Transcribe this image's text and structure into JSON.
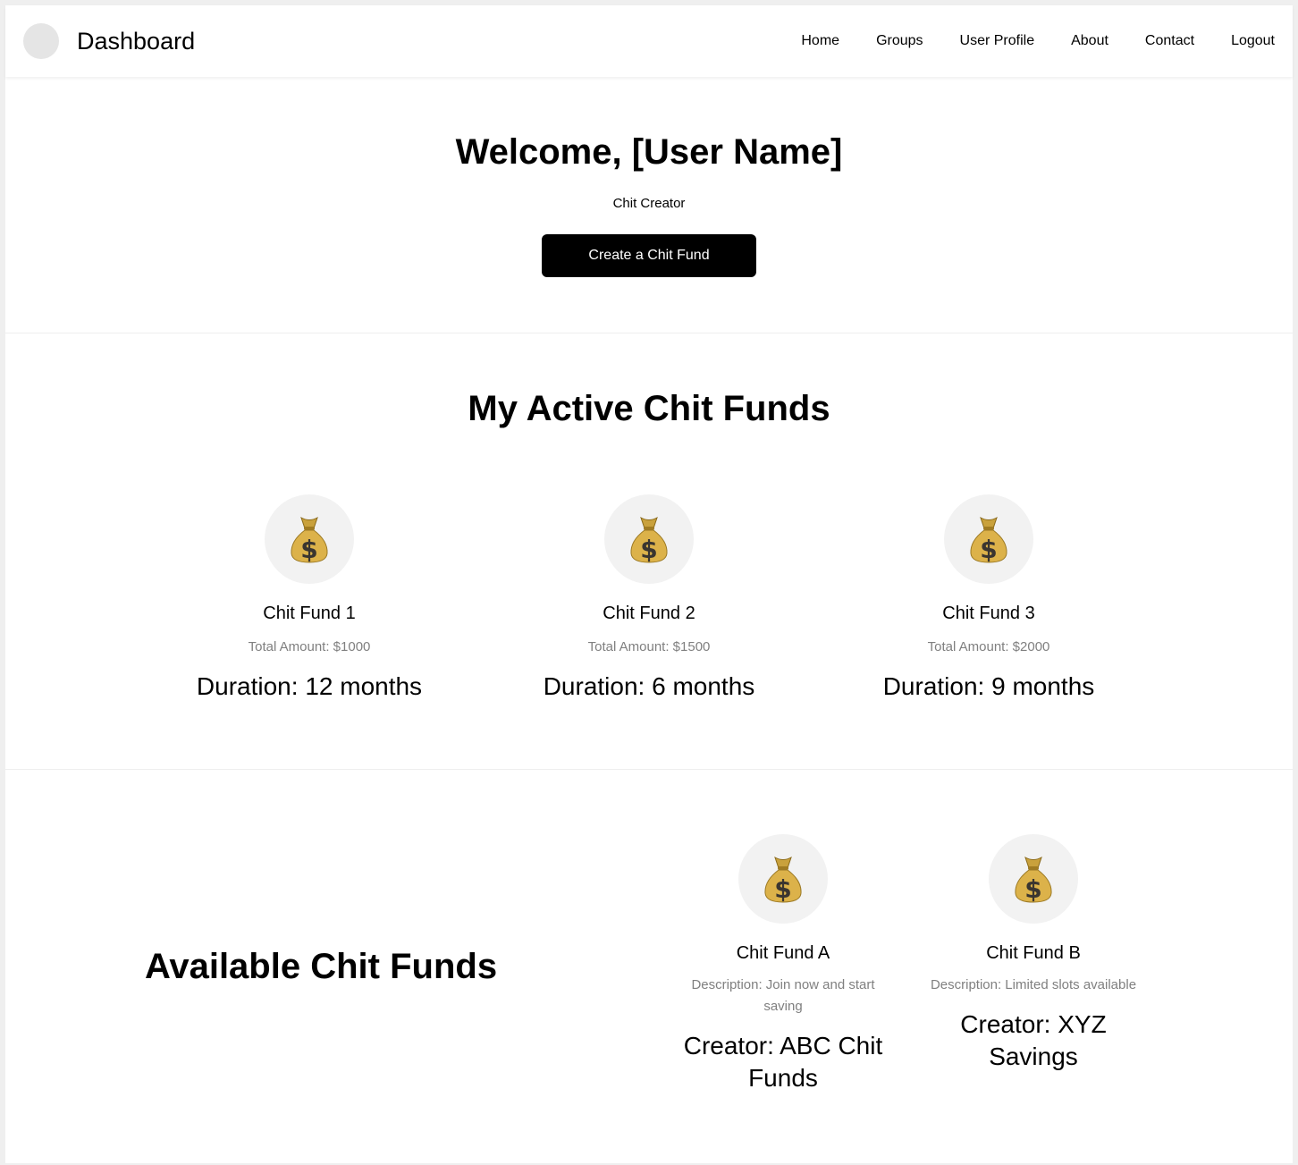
{
  "header": {
    "title": "Dashboard",
    "nav": [
      "Home",
      "Groups",
      "User Profile",
      "About",
      "Contact",
      "Logout"
    ]
  },
  "welcome": {
    "title": "Welcome, [User Name]",
    "role": "Chit Creator",
    "button": "Create a Chit Fund"
  },
  "active": {
    "title": "My Active Chit Funds",
    "cards": [
      {
        "icon": "money-bag-icon",
        "name": "Chit Fund 1",
        "amount": "Total Amount: $1000",
        "duration": "Duration: 12 months"
      },
      {
        "icon": "money-bag-icon",
        "name": "Chit Fund 2",
        "amount": "Total Amount: $1500",
        "duration": "Duration: 6 months"
      },
      {
        "icon": "money-bag-icon",
        "name": "Chit Fund 3",
        "amount": "Total Amount: $2000",
        "duration": "Duration: 9 months"
      }
    ]
  },
  "available": {
    "title": "Available Chit Funds",
    "cards": [
      {
        "icon": "money-bag-icon",
        "name": "Chit Fund A",
        "description": "Description: Join now and start saving",
        "creator": "Creator: ABC Chit Funds"
      },
      {
        "icon": "money-bag-icon",
        "name": "Chit Fund B",
        "description": "Description: Limited slots available",
        "creator": "Creator: XYZ Savings"
      }
    ]
  }
}
